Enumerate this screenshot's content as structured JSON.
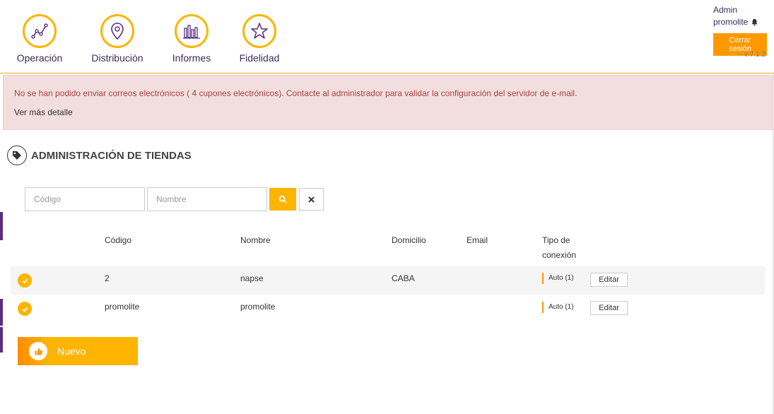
{
  "nav": {
    "items": [
      {
        "label": "Operación",
        "icon": "chart-line-icon"
      },
      {
        "label": "Distribución",
        "icon": "map-pin-icon"
      },
      {
        "label": "Informes",
        "icon": "bar-chart-icon"
      },
      {
        "label": "Fidelidad",
        "icon": "star-icon"
      }
    ]
  },
  "user": {
    "role": "Admin",
    "name": "promolite",
    "logout_label": "Cerrar sesión",
    "version": "v 7.1.2"
  },
  "alert": {
    "message": "No se han podido enviar correos electrónicos ( 4 cupones electrónicos). Contacte al administrador para validar la configuración del servidor de e-mail.",
    "link": "Ver más detalle"
  },
  "page": {
    "title": "ADMINISTRACIÓN DE TIENDAS"
  },
  "filters": {
    "code_placeholder": "Código",
    "name_placeholder": "Nombre"
  },
  "table": {
    "headers": {
      "code": "Código",
      "name": "Nombre",
      "address": "Domicilio",
      "email": "Email",
      "connection_line1": "Tipo de",
      "connection_line2": "conexión"
    },
    "rows": [
      {
        "code": "2",
        "name": "napse",
        "address": "CABA",
        "email": "",
        "connection": "Auto (1)",
        "edit": "Editar"
      },
      {
        "code": "promolite",
        "name": "promolite",
        "address": "",
        "email": "",
        "connection": "Auto (1)",
        "edit": "Editar"
      }
    ]
  },
  "actions": {
    "new_label": "Nuevo"
  },
  "colors": {
    "accent": "#ffb400",
    "brand_purple": "#5b2d83",
    "alert_bg": "#f2dede",
    "alert_text": "#a94442"
  }
}
